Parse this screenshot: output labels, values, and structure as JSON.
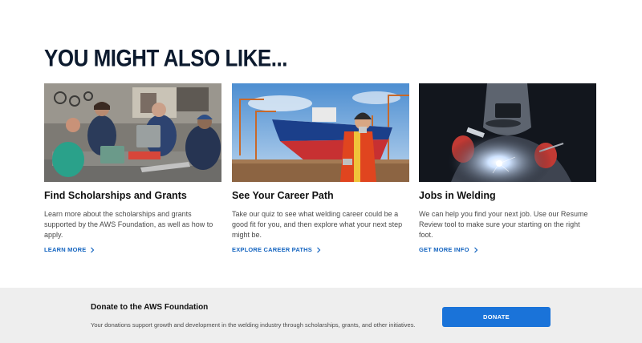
{
  "section": {
    "heading": "YOU MIGHT ALSO LIKE..."
  },
  "cards": [
    {
      "title": "Find Scholarships and Grants",
      "description": "Learn more about the scholarships and grants supported by the AWS Foundation, as well as how to apply.",
      "link_label": "LEARN MORE",
      "link_icon": "chevron-right-icon",
      "image": "students-welding-workshop-photo"
    },
    {
      "title": "See Your Career Path",
      "description": "Take our quiz to see what welding career could be a good fit for you, and then explore what your next step might be.",
      "link_label": "EXPLORE CAREER PATHS",
      "link_icon": "chevron-right-icon",
      "image": "shipyard-worker-photo"
    },
    {
      "title": "Jobs in Welding",
      "description": "We can help you find your next job. Use our Resume Review tool to make sure your starting on the right foot.",
      "link_label": "GET MORE INFO",
      "link_icon": "chevron-right-icon",
      "image": "welder-in-helmet-photo"
    }
  ],
  "donate": {
    "title": "Donate to the AWS Foundation",
    "description": "Your donations support growth and development in the welding industry through scholarships, grants, and other initiatives.",
    "button_label": "DONATE"
  },
  "colors": {
    "heading": "#0c1a2e",
    "link": "#1565c0",
    "button": "#1a73d9",
    "band": "#eeeeee"
  }
}
